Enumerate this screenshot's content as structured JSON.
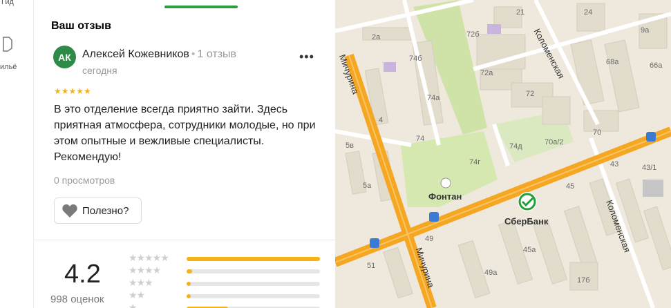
{
  "rail": {
    "guide_label": "Гид",
    "style_label": "ильё"
  },
  "review_section": {
    "title": "Ваш отзыв",
    "avatar_initials": "АК",
    "author_name": "Алексей Кожевников",
    "separator": "•",
    "author_review_count": "1 отзыв",
    "date": "сегодня",
    "more_label": "•••",
    "stars": "★★★★★",
    "rating_value": 5,
    "text": "В это отделение всегда приятно зайти. Здесь приятная атмосфера, сотрудники молодые, но при этом опытные и вежливые специалисты. Рекомендую!",
    "views": "0 просмотров",
    "useful_label": "Полезно?",
    "heart_icon": "heart-icon"
  },
  "summary": {
    "rating": "4.2",
    "ratings_count": "998 оценок",
    "histogram": [
      {
        "stars": "★★★★★",
        "fraction": 1.0
      },
      {
        "stars": "★★★★",
        "fraction": 0.04
      },
      {
        "stars": "★★★",
        "fraction": 0.03
      },
      {
        "stars": "★★",
        "fraction": 0.03
      },
      {
        "stars": "★",
        "fraction": 0.31
      }
    ],
    "accent_color": "#f6b317"
  },
  "map": {
    "streets": {
      "michurina_top": "Мичурина",
      "michurina_bottom": "Мичурина",
      "kolomenskaya_top": "Коломенская",
      "kolomenskaya_bottom": "Коломенская"
    },
    "houses": [
      "2а",
      "72б",
      "21",
      "24",
      "9а",
      "74б",
      "72а",
      "68а",
      "66а",
      "74а",
      "72",
      "4",
      "74",
      "74д",
      "70а/2",
      "70",
      "5в",
      "74г",
      "43",
      "43/1",
      "5а",
      "45",
      "49",
      "51",
      "49а",
      "45а",
      "17б"
    ],
    "poi": {
      "fountain": "Фонтан",
      "bank": "СберБанк"
    },
    "colors": {
      "road": "#f5a623",
      "park": "#cfe3a9",
      "building": "#e2dccd",
      "bank_brand": "#21a038"
    }
  }
}
